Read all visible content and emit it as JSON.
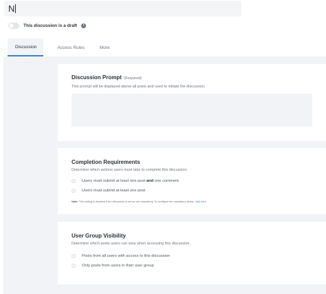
{
  "title_input": {
    "value": "N"
  },
  "draft": {
    "label": "This discussion is a draft",
    "info_icon": "info-icon",
    "enabled": false
  },
  "tabs": [
    {
      "label": "Discussion",
      "active": true
    },
    {
      "label": "Access Rules",
      "active": false
    },
    {
      "label": "More",
      "active": false
    }
  ],
  "discussion_prompt": {
    "title": "Discussion Prompt",
    "required": "(Required)",
    "description": "This prompt will be displayed above all posts and used to initiate the discussion."
  },
  "completion": {
    "title": "Completion Requirements",
    "description": "Determine which actions users must take to complete this discussion.",
    "option1_pre": "Users must submit at least one post ",
    "option1_bold": "and",
    "option1_post": " one comment",
    "option2": "Users must submit at least one post",
    "note_label": "Note:",
    "note_text": " This setting is disabled if the discussion is set as non-mandatory. To configure the mandatory status, ",
    "note_link": "click here."
  },
  "visibility": {
    "title": "User Group Visibility",
    "description": "Determine which posts users can view when accessing this discussion.",
    "option1": "Posts from all users with access to this discussion",
    "option2": "Only posts from users in their user group"
  },
  "colors": {
    "accent": "#3b82c4",
    "panel": "#f1f3f6",
    "text": "#2b2f36",
    "muted": "#6b7280"
  }
}
